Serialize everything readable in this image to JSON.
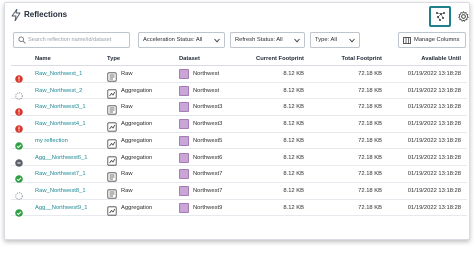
{
  "header": {
    "title": "Reflections",
    "icons": {
      "title": "reflection-bolt-icon",
      "action": "graph-icon",
      "settings": "gear-icon"
    }
  },
  "toolbar": {
    "search_placeholder": "Search reflection name/id/dataset",
    "filters": [
      {
        "label": "Acceleration Status: All"
      },
      {
        "label": "Refresh Status: All"
      },
      {
        "label": "Type: All"
      }
    ],
    "manage_columns": "Manage Columns"
  },
  "columns": [
    "Name",
    "Type",
    "Dataset",
    "Current Footprint",
    "Total Footprint",
    "Available Until"
  ],
  "status_colors": {
    "error": "#d9362c",
    "ok": "#2ea043",
    "pending": "#8a8f96",
    "expired": "#d9362c"
  },
  "rows": [
    {
      "status": "error",
      "name": "Raw_Northwest_1",
      "type": "Raw",
      "dataset": "Northwest",
      "current": "8.12 KB",
      "total": "72.18 KB",
      "until": "01/19/2022 13:18:28"
    },
    {
      "status": "pending",
      "name": "Raw_Northwest_2",
      "type": "Aggregation",
      "dataset": "Northwest",
      "current": "8.12 KB",
      "total": "72.18 KB",
      "until": "01/19/2022 13:18:28"
    },
    {
      "status": "error",
      "name": "Raw_Northwest3_1",
      "type": "Raw",
      "dataset": "Northwest3",
      "current": "8.12 KB",
      "total": "72.18 KB",
      "until": "01/19/2022 13:18:28"
    },
    {
      "status": "error",
      "name": "Raw_Northwest4_1",
      "type": "Aggregation",
      "dataset": "Northwest3",
      "current": "8.12 KB",
      "total": "72.18 KB",
      "until": "01/19/2022 13:18:28"
    },
    {
      "status": "ok",
      "name": "my reflection",
      "type": "Aggregation",
      "dataset": "Northwest5",
      "current": "8.12 KB",
      "total": "72.18 KB",
      "until": "01/19/2022 13:18:28"
    },
    {
      "status": "expired",
      "name": "Agg__Northwest6_1",
      "type": "Aggregation",
      "dataset": "Northwest6",
      "current": "8.12 KB",
      "total": "72.18 KB",
      "until": "01/19/2022 13:18:28"
    },
    {
      "status": "ok",
      "name": "Raw_Northwest7_1",
      "type": "Raw",
      "dataset": "Northwest7",
      "current": "8.12 KB",
      "total": "72.18 KB",
      "until": "01/19/2022 13:18:28"
    },
    {
      "status": "pending",
      "name": "Raw_Northwest8_1",
      "type": "Raw",
      "dataset": "Northwest7",
      "current": "8.12 KB",
      "total": "72.18 KB",
      "until": "01/19/2022 13:18:28"
    },
    {
      "status": "ok",
      "name": "Agg__Northwest9_1",
      "type": "Aggregation",
      "dataset": "Northwest9",
      "current": "8.12 KB",
      "total": "72.18 KB",
      "until": "01/19/2022 13:18:28"
    }
  ]
}
